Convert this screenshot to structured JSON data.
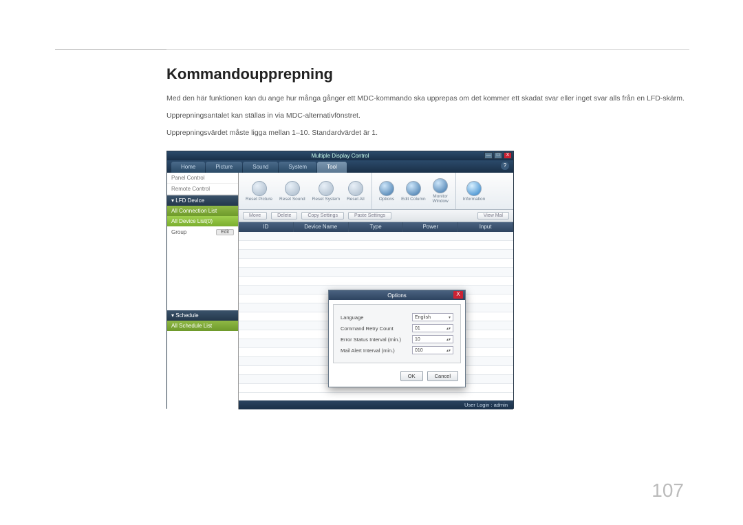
{
  "page": {
    "heading": "Kommandoupprepning",
    "p1": "Med den här funktionen kan du ange hur många gånger ett MDC-kommando ska upprepas om det kommer ett skadat svar eller inget svar alls från en LFD-skärm.",
    "p2": "Upprepningsantalet kan ställas in via MDC-alternativfönstret.",
    "p3": "Upprepningsvärdet måste ligga mellan 1–10. Standardvärdet är 1.",
    "number": "107"
  },
  "app": {
    "title": "Multiple Display Control",
    "win": {
      "min": "—",
      "max": "□",
      "close": "X"
    },
    "help": "?",
    "tabs": [
      "Home",
      "Picture",
      "Sound",
      "System",
      "Tool"
    ],
    "activeTab": 4,
    "toolbar": {
      "reset": [
        "Reset Picture",
        "Reset Sound",
        "Reset System",
        "Reset All"
      ],
      "right": [
        {
          "label": "Options"
        },
        {
          "label": "Edit Column"
        },
        {
          "label": "Monitor\nWindow"
        },
        {
          "label": "Information"
        }
      ]
    },
    "actions": {
      "move": "Move",
      "delete": "Delete",
      "copy": "Copy Settings",
      "paste": "Paste Settings",
      "view": "View Mal"
    },
    "cols": [
      "ID",
      "Device Name",
      "Type",
      "Power",
      "Input"
    ],
    "sidebar": {
      "panel": "Panel Control",
      "remote": "Remote Control",
      "lfd": "▾  LFD Device",
      "allconn": "All Connection List",
      "alldev": "All Device List(0)",
      "group": "Group",
      "edit": "Edit",
      "sched": "▾  Schedule",
      "allsched": "All Schedule List"
    },
    "status": "User Login : admin",
    "dialog": {
      "title": "Options",
      "close": "X",
      "rows": [
        {
          "label": "Language",
          "value": "English",
          "type": "select"
        },
        {
          "label": "Command Retry Count",
          "value": "01",
          "type": "spin"
        },
        {
          "label": "Error Status Interval (min.)",
          "value": "10",
          "type": "spin"
        },
        {
          "label": "Mail Alert Interval (min.)",
          "value": "010",
          "type": "spin"
        }
      ],
      "ok": "OK",
      "cancel": "Cancel"
    }
  }
}
